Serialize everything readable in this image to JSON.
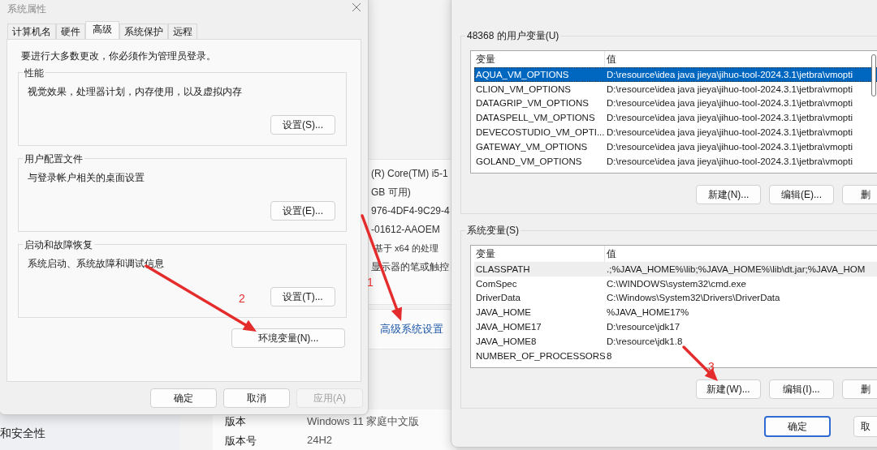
{
  "settings_page": {
    "specs": [
      "(R) Core(TM) i5-1",
      "GB 可用)",
      "976-4DF4-9C29-4",
      "-01612-AAOEM",
      "基于 x64 的处理",
      "显示器的笔或触控"
    ],
    "link": "高级系统设置",
    "sidebar_item": "和安全性",
    "rows": [
      {
        "label": "版本",
        "value": "Windows 11 家庭中文版"
      },
      {
        "label": "版本号",
        "value": "24H2"
      }
    ]
  },
  "system_properties": {
    "title": "系统属性",
    "tabs": [
      {
        "label": "计算机名",
        "selected": false
      },
      {
        "label": "硬件",
        "selected": false
      },
      {
        "label": "高级",
        "selected": true
      },
      {
        "label": "系统保护",
        "selected": false
      },
      {
        "label": "远程",
        "selected": false
      }
    ],
    "note": "要进行大多数更改，你必须作为管理员登录。",
    "groups": [
      {
        "title": "性能",
        "description": "视觉效果，处理器计划，内存使用，以及虚拟内存",
        "button": "设置(S)..."
      },
      {
        "title": "用户配置文件",
        "description": "与登录帐户相关的桌面设置",
        "button": "设置(E)..."
      },
      {
        "title": "启动和故障恢复",
        "description": "系统启动、系统故障和调试信息",
        "button": "设置(T)..."
      }
    ],
    "env_button": "环境变量(N)...",
    "buttons": [
      {
        "label": "确定",
        "disabled": false
      },
      {
        "label": "取消",
        "disabled": false
      },
      {
        "label": "应用(A)",
        "disabled": true
      }
    ]
  },
  "env_vars": {
    "user_group": "48368 的用户变量(U)",
    "user_table": {
      "columns": [
        "变量",
        "值"
      ],
      "rows": [
        {
          "name": "AQUA_VM_OPTIONS",
          "value": "D:\\resource\\idea java jieya\\jihuo-tool-2024.3.1\\jetbra\\vmopti",
          "selected": true
        },
        {
          "name": "CLION_VM_OPTIONS",
          "value": "D:\\resource\\idea java jieya\\jihuo-tool-2024.3.1\\jetbra\\vmopti",
          "selected": false
        },
        {
          "name": "DATAGRIP_VM_OPTIONS",
          "value": "D:\\resource\\idea java jieya\\jihuo-tool-2024.3.1\\jetbra\\vmopti",
          "selected": false
        },
        {
          "name": "DATASPELL_VM_OPTIONS",
          "value": "D:\\resource\\idea java jieya\\jihuo-tool-2024.3.1\\jetbra\\vmopti",
          "selected": false
        },
        {
          "name": "DEVECOSTUDIO_VM_OPTI...",
          "value": "D:\\resource\\idea java jieya\\jihuo-tool-2024.3.1\\jetbra\\vmopti",
          "selected": false
        },
        {
          "name": "GATEWAY_VM_OPTIONS",
          "value": "D:\\resource\\idea java jieya\\jihuo-tool-2024.3.1\\jetbra\\vmopti",
          "selected": false
        },
        {
          "name": "GOLAND_VM_OPTIONS",
          "value": "D:\\resource\\idea java jieya\\jihuo-tool-2024.3.1\\jetbra\\vmopti",
          "selected": false
        }
      ]
    },
    "user_buttons": [
      "新建(N)...",
      "编辑(E)...",
      "删"
    ],
    "system_group": "系统变量(S)",
    "system_table": {
      "columns": [
        "变量",
        "值"
      ],
      "rows": [
        {
          "name": "CLASSPATH",
          "value": ".;%JAVA_HOME%\\lib;%JAVA_HOME%\\lib\\dt.jar;%JAVA_HOM",
          "hovered": true
        },
        {
          "name": "ComSpec",
          "value": "C:\\WINDOWS\\system32\\cmd.exe",
          "hovered": false
        },
        {
          "name": "DriverData",
          "value": "C:\\Windows\\System32\\Drivers\\DriverData",
          "hovered": false
        },
        {
          "name": "JAVA_HOME",
          "value": "%JAVA_HOME17%",
          "hovered": false
        },
        {
          "name": "JAVA_HOME17",
          "value": "D:\\resource\\jdk17",
          "hovered": false
        },
        {
          "name": "JAVA_HOME8",
          "value": "D:\\resource\\jdk1.8",
          "hovered": false
        },
        {
          "name": "NUMBER_OF_PROCESSORS",
          "value": "8",
          "hovered": false
        }
      ]
    },
    "system_buttons": [
      "新建(W)...",
      "编辑(I)...",
      "删"
    ],
    "buttons": [
      {
        "label": "确定",
        "focused": true
      },
      {
        "label": "取",
        "focused": false
      }
    ]
  },
  "annotations": [
    {
      "label": "1"
    },
    {
      "label": "2"
    },
    {
      "label": "3"
    }
  ]
}
